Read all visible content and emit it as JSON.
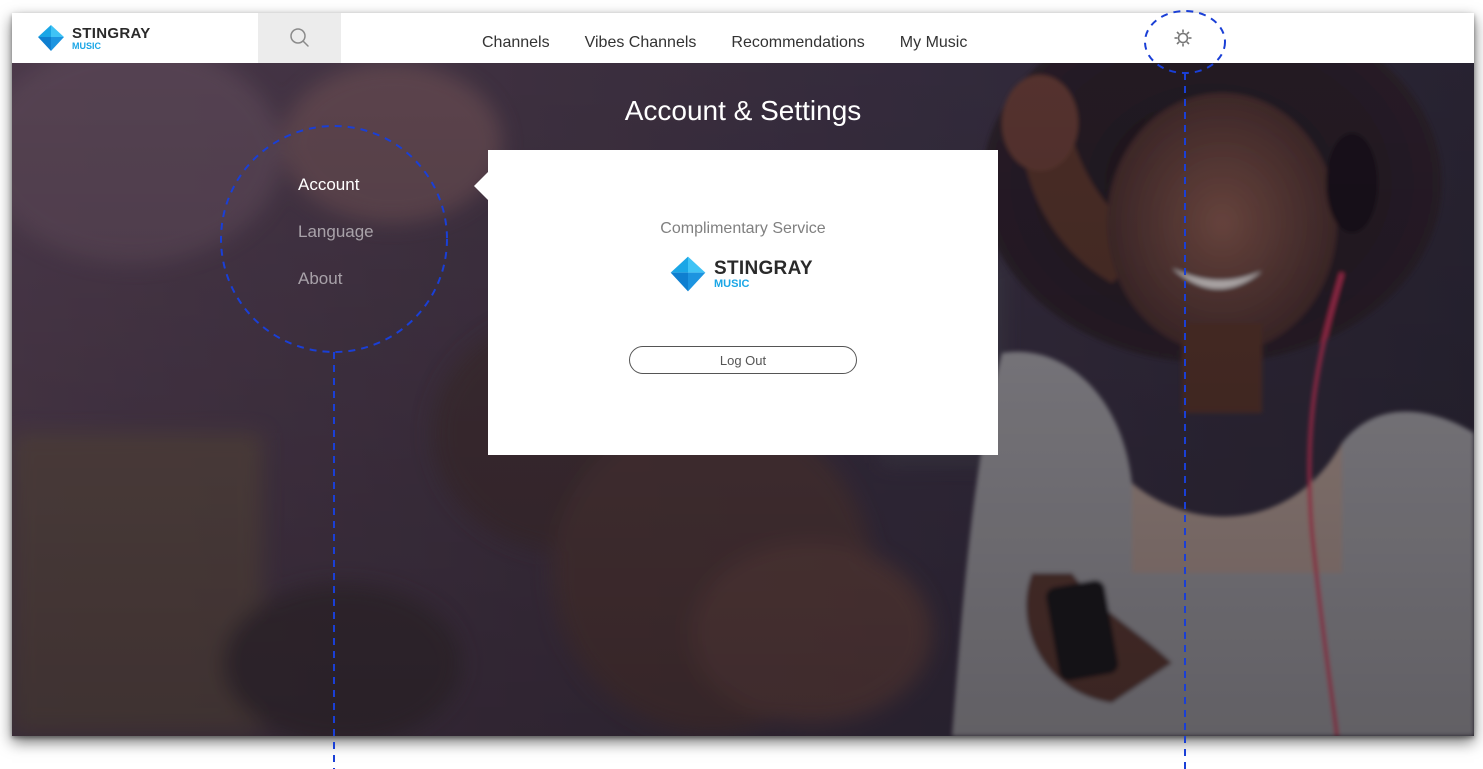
{
  "app": {
    "brand": "STINGRAY",
    "brand_sub": "MUSIC"
  },
  "nav": {
    "items": [
      {
        "label": "Channels"
      },
      {
        "label": "Vibes Channels"
      },
      {
        "label": "Recommendations"
      },
      {
        "label": "My Music"
      }
    ]
  },
  "icons": {
    "search": "search-icon",
    "settings": "gear-icon"
  },
  "page": {
    "title": "Account & Settings"
  },
  "settings_menu": {
    "items": [
      {
        "label": "Account",
        "active": true
      },
      {
        "label": "Language",
        "active": false
      },
      {
        "label": "About",
        "active": false
      }
    ]
  },
  "account_panel": {
    "service_label": "Complimentary Service",
    "brand": "STINGRAY",
    "brand_sub": "MUSIC",
    "logout_label": "Log Out"
  },
  "colors": {
    "brand_blue": "#1aa6e6",
    "annotation_blue": "#1a3fd6",
    "topbar_bg": "#ffffff",
    "search_bg": "#ececec"
  }
}
